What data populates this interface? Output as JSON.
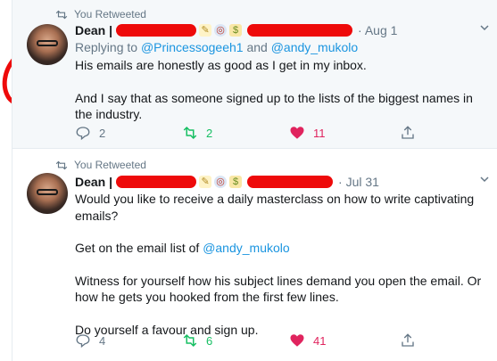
{
  "tweets": [
    {
      "retweet_label": "You Retweeted",
      "author_name": "Dean |",
      "date": "· Aug 1",
      "replying_prefix": "Replying to ",
      "mention_1": "@Princessogeeh1",
      "replying_and": " and ",
      "mention_2": "@andy_mukolo",
      "paragraphs": [
        "His emails are honestly as good as I get in my inbox.",
        "And I say that as someone signed up to the lists of the biggest names in the industry."
      ],
      "reply_count": "2",
      "retweet_count": "2",
      "like_count": "11"
    },
    {
      "retweet_label": "You Retweeted",
      "author_name": "Dean |",
      "date": "· Jul 31",
      "paragraphs": [
        "Would you like to receive a daily masterclass on how to write captivating emails?",
        "",
        "Witness for yourself how his subject lines demand you open the email. Or how he gets you hooked from the first few lines.",
        "Do yourself a favour and sign up."
      ],
      "list_prefix": "Get on the email list of ",
      "list_mention": "@andy_mukolo",
      "reply_count": "4",
      "retweet_count": "6",
      "like_count": "41"
    }
  ],
  "colors": {
    "accent": "#1b95e0",
    "retweet": "#17bf63",
    "like": "#e0245e",
    "redaction": "#ee0a0a",
    "muted": "#657786"
  },
  "icons": [
    "retweet-icon",
    "chevron-down-icon",
    "reply-icon",
    "heart-icon",
    "share-icon",
    "memo-emoji-icon",
    "target-emoji-icon",
    "money-bag-emoji-icon"
  ]
}
